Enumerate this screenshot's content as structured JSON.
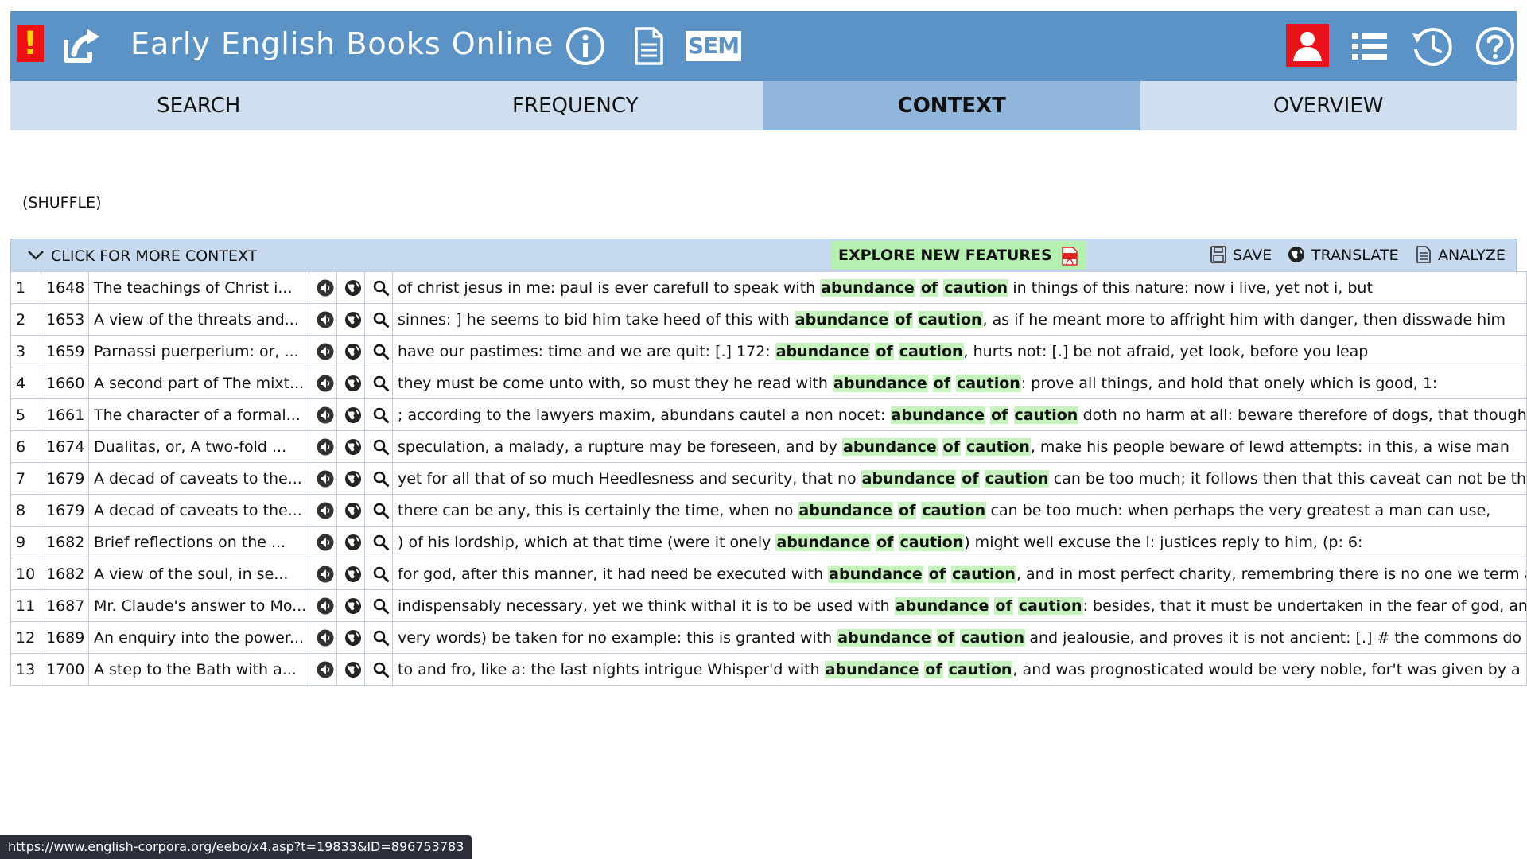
{
  "header": {
    "alert_label": "!",
    "title": "Early English Books Online",
    "sem_label": "SEM",
    "icons": [
      "external-link-icon",
      "info-icon",
      "document-icon",
      "sem-icon",
      "user-icon",
      "list-icon",
      "history-icon",
      "help-icon"
    ]
  },
  "tabs": [
    {
      "label": "SEARCH",
      "active": false
    },
    {
      "label": "FREQUENCY",
      "active": false
    },
    {
      "label": "CONTEXT",
      "active": true
    },
    {
      "label": "OVERVIEW",
      "active": false
    }
  ],
  "shuffle_label": "(SHUFFLE)",
  "toolbar": {
    "more_context_label": "CLICK FOR MORE CONTEXT",
    "explore_label": "EXPLORE NEW FEATURES",
    "save_label": "SAVE",
    "translate_label": "TRANSLATE",
    "analyze_label": "ANALYZE"
  },
  "keyword": [
    "abundance",
    "of",
    "caution"
  ],
  "rows": [
    {
      "num": "1",
      "year": "1648",
      "title": "The teachings of Christ i...",
      "before": "of christ jesus in me: paul is ever carefull to speak with",
      "after": "in things of this nature: now i live, yet not i, but"
    },
    {
      "num": "2",
      "year": "1653",
      "title": "A view of the threats and...",
      "before": "sinnes: ] he seems to bid him take heed of this with",
      "after": ", as if he meant more to affright him with danger, then disswade him"
    },
    {
      "num": "3",
      "year": "1659",
      "title": "Parnassi puerperium: or, ...",
      "before": "have our pastimes: time and we are quit: [.] 172:",
      "after": ", hurts not: [.] be not afraid, yet look, before you leap"
    },
    {
      "num": "4",
      "year": "1660",
      "title": "A second part of The mixt...",
      "before": "they must be come unto with, so must they he read with",
      "after": ": prove all things, and hold that onely which is good, 1:"
    },
    {
      "num": "5",
      "year": "1661",
      "title": "The character of a formal...",
      "before": "; according to the lawyers maxim, abundans cautel a non nocet:",
      "after": "doth no harm at all: beware therefore of dogs, that though they have"
    },
    {
      "num": "6",
      "year": "1674",
      "title": "Dualitas, or, A two-fold ...",
      "before": "speculation, a malady, a rupture may be foreseen, and by",
      "after": ", make his people beware of lewd attempts: in this, a wise man"
    },
    {
      "num": "7",
      "year": "1679",
      "title": "A decad of caveats to the...",
      "before": "yet for all that of so much Heedlesness and security, that no",
      "after": "can be too much; it follows then that this caveat can not be thought"
    },
    {
      "num": "8",
      "year": "1679",
      "title": "A decad of caveats to the...",
      "before": "there can be any, this is certainly the time, when no",
      "after": "can be too much: when perhaps the very greatest a man can use,"
    },
    {
      "num": "9",
      "year": "1682",
      "title": "Brief reflections on the ...",
      "before": ") of his lordship, which at that time (were it onely",
      "after": ") might well excuse the l: justices reply to him, (p: 6:"
    },
    {
      "num": "10",
      "year": "1682",
      "title": "A view of the soul, in se...",
      "before": "for god, after this manner, it had need be executed with",
      "after": ", and in most perfect charity, remembring there is no one we term atheist"
    },
    {
      "num": "11",
      "year": "1687",
      "title": "Mr. Claude's answer to Mo...",
      "before": "indispensably necessary, yet we think withal it is to be used with",
      "after": ": besides, that it must be undertaken in the fear of god, and"
    },
    {
      "num": "12",
      "year": "1689",
      "title": "An enquiry into the power...",
      "before": "very words) be taken for no example: this is granted with",
      "after": "and jealousie, and proves it is not ancient: [.] # the commons do"
    },
    {
      "num": "13",
      "year": "1700",
      "title": "A step to the Bath with a...",
      "before": "to and fro, like a: the last nights intrigue Whisper'd with",
      "after": ", and was prognosticated would be very noble, for't was given by a"
    }
  ],
  "status_url": "https://www.english-corpora.org/eebo/x4.asp?t=19833&ID=896753783",
  "colors": {
    "header_bg": "#5b93c7",
    "tab_bg": "#cfdff0",
    "tab_active_bg": "#91b6dc",
    "toolbar_bg": "#c6d9ee",
    "keyword_highlight": "#c6f2bd",
    "explore_bg": "#b6f0b0",
    "alert_red": "#ee1111"
  }
}
